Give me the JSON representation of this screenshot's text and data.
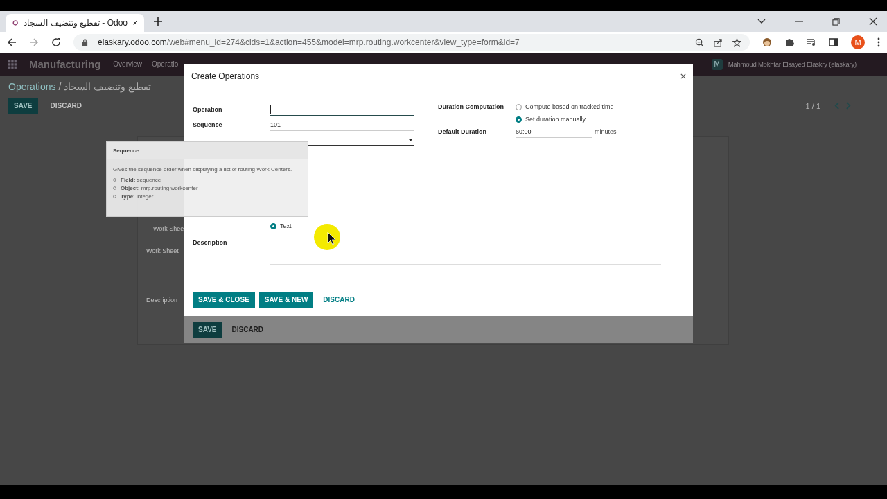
{
  "browser": {
    "tab_title": "تقطيع وتنضيف السجاد - Odoo",
    "url_host": "elaskary.odoo.com",
    "url_path": "/web#menu_id=274&cids=1&action=455&model=mrp.routing.workcenter&view_type=form&id=7",
    "profile_initial": "M"
  },
  "app": {
    "name": "Manufacturing",
    "menu": [
      "Overview",
      "Operatio"
    ],
    "user_initial": "M",
    "user_name": "Mahmoud Mokhtar Elsayed Elaskry (elaskary)"
  },
  "breadcrumb": {
    "parent": "Operations",
    "separator": "/",
    "current": "تقطيع وتنضيف السجاد"
  },
  "actions": [
    {
      "label": "SAVE",
      "kind": "primary"
    },
    {
      "label": "DISCARD",
      "kind": "link"
    }
  ],
  "pager": "1 / 1",
  "background_labels": [
    "Work Shee",
    "Work Sheet",
    "Description"
  ],
  "dialog": {
    "title": "Create Operations",
    "left_fields": [
      {
        "label": "Operation",
        "focused": true
      },
      {
        "label": "Sequence",
        "value": "101",
        "focused": false
      }
    ],
    "duration_label": "Duration Computation",
    "duration_options": [
      {
        "label": "Compute based on tracked time",
        "selected": false
      },
      {
        "label": "Set duration manually",
        "selected": true
      }
    ],
    "default_duration": {
      "label": "Default Duration",
      "value": "60:00",
      "unit": "minutes"
    },
    "worksheet_options": [
      {
        "label": "Text",
        "selected": true
      }
    ],
    "description_label": "Description",
    "buttons": [
      {
        "label": "SAVE & CLOSE",
        "kind": "primary"
      },
      {
        "label": "SAVE & NEW",
        "kind": "primary"
      },
      {
        "label": "DISCARD",
        "kind": "link"
      }
    ],
    "under_buttons": [
      {
        "label": "SAVE",
        "kind": "primary"
      },
      {
        "label": "DISCARD",
        "kind": "link"
      }
    ]
  },
  "tooltip": {
    "title": "Sequence",
    "text": "Gives the sequence order when displaying a list of routing Work Centers.",
    "items": [
      {
        "key": "Field:",
        "value": "sequence"
      },
      {
        "key": "Object:",
        "value": "mrp.routing.workcenter"
      },
      {
        "key": "Type:",
        "value": "integer"
      }
    ]
  }
}
